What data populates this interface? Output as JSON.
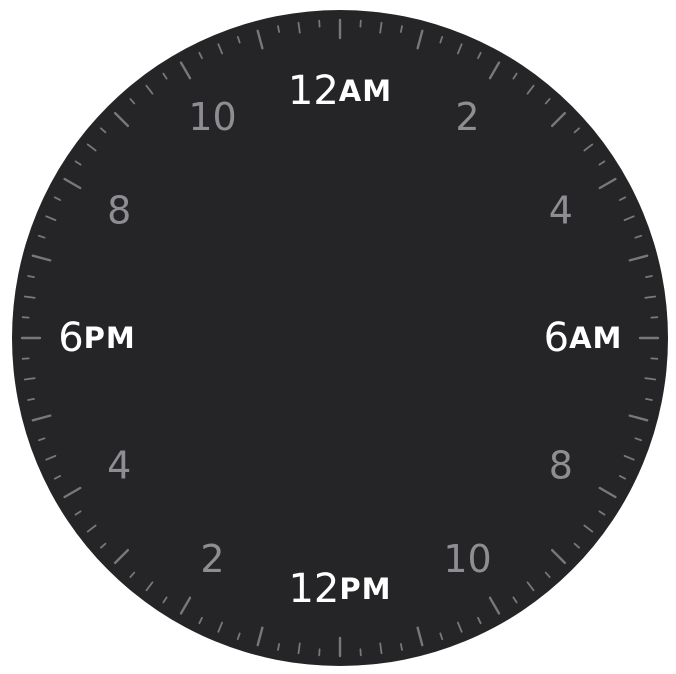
{
  "dial": {
    "face_color": "#252527",
    "major_label_color": "#ffffff",
    "minor_label_color": "#8d8d92",
    "tick_color": "#77777c",
    "major_labels": [
      {
        "hour": 0,
        "number": "12",
        "suffix": "AM"
      },
      {
        "hour": 6,
        "number": "6",
        "suffix": "AM"
      },
      {
        "hour": 12,
        "number": "12",
        "suffix": "PM"
      },
      {
        "hour": 18,
        "number": "6",
        "suffix": "PM"
      }
    ],
    "minor_labels": [
      {
        "hour": 2,
        "text": "2"
      },
      {
        "hour": 4,
        "text": "4"
      },
      {
        "hour": 8,
        "text": "8"
      },
      {
        "hour": 10,
        "text": "10"
      },
      {
        "hour": 14,
        "text": "2"
      },
      {
        "hour": 16,
        "text": "4"
      },
      {
        "hour": 20,
        "text": "8"
      },
      {
        "hour": 22,
        "text": "10"
      }
    ],
    "hours_per_dial": 24,
    "ticks_per_hour": 4
  }
}
